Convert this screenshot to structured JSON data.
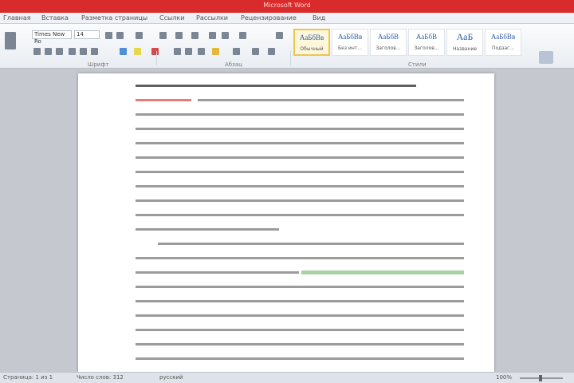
{
  "window": {
    "title": "Microsoft Word"
  },
  "ribbon_tabs": [
    "Главная",
    "Вставка",
    "Разметка страницы",
    "Ссылки",
    "Рассылки",
    "Рецензирование",
    "Вид"
  ],
  "ribbon": {
    "font_name": "Times New Ro",
    "font_size": "14",
    "group_labels": [
      "Шрифт",
      "Абзац",
      "Стили"
    ],
    "styles": [
      {
        "preview": "АаБбВв",
        "name": "Обычный"
      },
      {
        "preview": "АаБбВв",
        "name": "Без инт..."
      },
      {
        "preview": "АаБбВ",
        "name": "Заголов..."
      },
      {
        "preview": "АаБбВ",
        "name": "Заголов..."
      },
      {
        "preview": "АаБ",
        "name": "Название"
      },
      {
        "preview": "АаБбВв",
        "name": "Подзаг..."
      }
    ]
  },
  "statusbar": {
    "page": "Страница: 1 из 1",
    "words": "Число слов: 312",
    "language": "русский",
    "zoom": "100%"
  }
}
